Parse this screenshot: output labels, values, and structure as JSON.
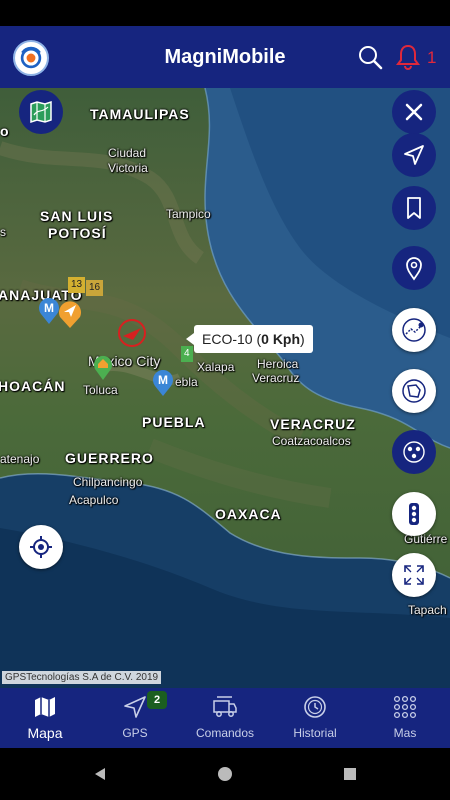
{
  "header": {
    "title": "MagniMobile",
    "notification_count": "1"
  },
  "map": {
    "labels": {
      "tamaulipas": "TAMAULIPAS",
      "ciudad_victoria_1": "Ciudad",
      "ciudad_victoria_2": "Victoria",
      "tampico": "Tampico",
      "san_luis_1": "SAN LUIS",
      "san_luis_2": "POTOSÍ",
      "guanajuato": "ANAJUATO",
      "mexico_city": "Mexico City",
      "toluca": "Toluca",
      "puebla_city": "ebla",
      "xalapa": "Xalapa",
      "heroica_veracruz_1": "Heroica",
      "heroica_veracruz_2": "Veracruz",
      "michoacan": "HOACÁN",
      "puebla": "PUEBLA",
      "veracruz": "VERACRUZ",
      "coatzacoalcos": "Coatzacoalcos",
      "guerrero": "GUERRERO",
      "atenajo": "atenajo",
      "chilpancingo": "Chilpancingo",
      "acapulco": "Acapulco",
      "oaxaca": "OAXACA",
      "gutierrez": "Gutiérre",
      "tapachula": "Tapach",
      "left_cut_1": "o",
      "left_cut_2": "s"
    },
    "vehicle_callout": {
      "name": "ECO-10",
      "speed": "0 Kph"
    },
    "cluster_badges": {
      "b13": "13",
      "b16": "16",
      "b4": "4"
    },
    "copyright": "GPSTecnologías S.A de C.V. 2019"
  },
  "right_controls": [
    "close-icon",
    "navigation-arrow-icon",
    "bookmark-icon",
    "location-pin-icon",
    "route-map-icon",
    "geofence-map-icon",
    "points-of-interest-icon",
    "traffic-light-icon",
    "fullscreen-icon"
  ],
  "bottom_nav": {
    "items": [
      {
        "label": "Mapa",
        "icon": "map-icon",
        "active": true
      },
      {
        "label": "GPS",
        "icon": "gps-arrow-icon",
        "badge": "2"
      },
      {
        "label": "Comandos",
        "icon": "truck-commands-icon"
      },
      {
        "label": "Historial",
        "icon": "history-icon"
      },
      {
        "label": "Mas",
        "icon": "grid-more-icon"
      }
    ]
  },
  "colors": {
    "primary": "#16257f",
    "alert_red": "#e0283b",
    "badge_green": "#1b5e20",
    "marker_blue": "#3b86d6",
    "marker_orange": "#f0a030"
  }
}
